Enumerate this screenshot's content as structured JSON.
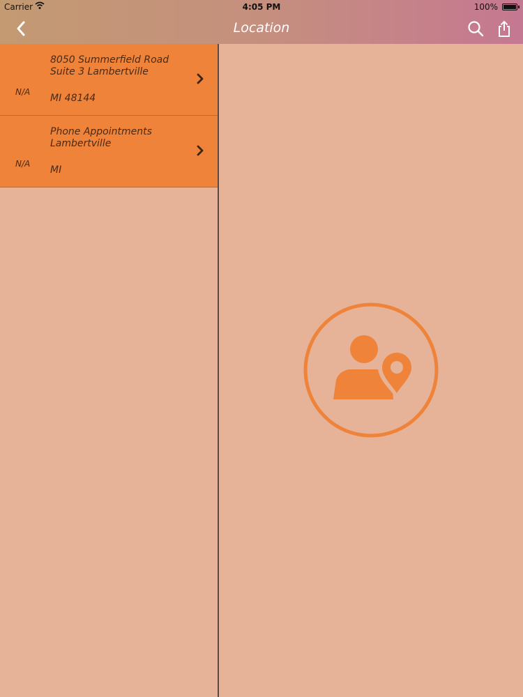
{
  "status_bar": {
    "carrier": "Carrier",
    "time": "4:05 PM",
    "battery": "100%"
  },
  "nav": {
    "title": "Location"
  },
  "locations": [
    {
      "badge": "N/A",
      "line1": "8050 Summerfield Road",
      "line2": "Suite 3 Lambertville",
      "line3": "MI 48144"
    },
    {
      "badge": "N/A",
      "line1": "Phone Appointments",
      "line2": "Lambertville",
      "line3": "MI"
    }
  ],
  "colors": {
    "background": "#e6b398",
    "list_item": "#ee8339",
    "accent": "#ee8339",
    "nav_gradient_start": "#c39a72",
    "nav_gradient_end": "#c57891"
  },
  "icons": {
    "back": "chevron-left-icon",
    "search": "search-icon",
    "share": "share-icon",
    "row_disclosure": "chevron-right-icon",
    "placeholder": "person-location-icon"
  }
}
